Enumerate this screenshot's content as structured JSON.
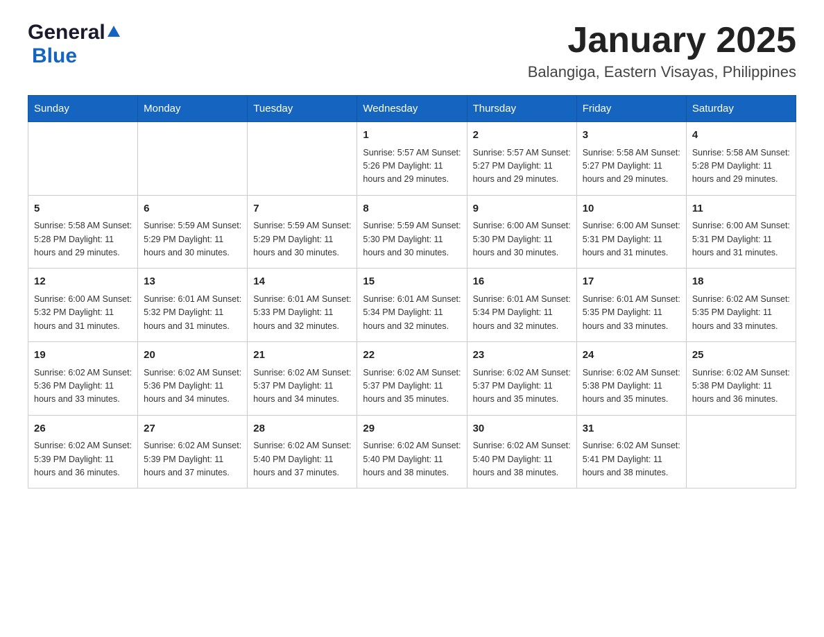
{
  "header": {
    "logo": {
      "general": "General",
      "blue": "Blue"
    },
    "month_title": "January 2025",
    "location": "Balangiga, Eastern Visayas, Philippines"
  },
  "calendar": {
    "days_of_week": [
      "Sunday",
      "Monday",
      "Tuesday",
      "Wednesday",
      "Thursday",
      "Friday",
      "Saturday"
    ],
    "weeks": [
      [
        {
          "day": "",
          "info": ""
        },
        {
          "day": "",
          "info": ""
        },
        {
          "day": "",
          "info": ""
        },
        {
          "day": "1",
          "info": "Sunrise: 5:57 AM\nSunset: 5:26 PM\nDaylight: 11 hours and 29 minutes."
        },
        {
          "day": "2",
          "info": "Sunrise: 5:57 AM\nSunset: 5:27 PM\nDaylight: 11 hours and 29 minutes."
        },
        {
          "day": "3",
          "info": "Sunrise: 5:58 AM\nSunset: 5:27 PM\nDaylight: 11 hours and 29 minutes."
        },
        {
          "day": "4",
          "info": "Sunrise: 5:58 AM\nSunset: 5:28 PM\nDaylight: 11 hours and 29 minutes."
        }
      ],
      [
        {
          "day": "5",
          "info": "Sunrise: 5:58 AM\nSunset: 5:28 PM\nDaylight: 11 hours and 29 minutes."
        },
        {
          "day": "6",
          "info": "Sunrise: 5:59 AM\nSunset: 5:29 PM\nDaylight: 11 hours and 30 minutes."
        },
        {
          "day": "7",
          "info": "Sunrise: 5:59 AM\nSunset: 5:29 PM\nDaylight: 11 hours and 30 minutes."
        },
        {
          "day": "8",
          "info": "Sunrise: 5:59 AM\nSunset: 5:30 PM\nDaylight: 11 hours and 30 minutes."
        },
        {
          "day": "9",
          "info": "Sunrise: 6:00 AM\nSunset: 5:30 PM\nDaylight: 11 hours and 30 minutes."
        },
        {
          "day": "10",
          "info": "Sunrise: 6:00 AM\nSunset: 5:31 PM\nDaylight: 11 hours and 31 minutes."
        },
        {
          "day": "11",
          "info": "Sunrise: 6:00 AM\nSunset: 5:31 PM\nDaylight: 11 hours and 31 minutes."
        }
      ],
      [
        {
          "day": "12",
          "info": "Sunrise: 6:00 AM\nSunset: 5:32 PM\nDaylight: 11 hours and 31 minutes."
        },
        {
          "day": "13",
          "info": "Sunrise: 6:01 AM\nSunset: 5:32 PM\nDaylight: 11 hours and 31 minutes."
        },
        {
          "day": "14",
          "info": "Sunrise: 6:01 AM\nSunset: 5:33 PM\nDaylight: 11 hours and 32 minutes."
        },
        {
          "day": "15",
          "info": "Sunrise: 6:01 AM\nSunset: 5:34 PM\nDaylight: 11 hours and 32 minutes."
        },
        {
          "day": "16",
          "info": "Sunrise: 6:01 AM\nSunset: 5:34 PM\nDaylight: 11 hours and 32 minutes."
        },
        {
          "day": "17",
          "info": "Sunrise: 6:01 AM\nSunset: 5:35 PM\nDaylight: 11 hours and 33 minutes."
        },
        {
          "day": "18",
          "info": "Sunrise: 6:02 AM\nSunset: 5:35 PM\nDaylight: 11 hours and 33 minutes."
        }
      ],
      [
        {
          "day": "19",
          "info": "Sunrise: 6:02 AM\nSunset: 5:36 PM\nDaylight: 11 hours and 33 minutes."
        },
        {
          "day": "20",
          "info": "Sunrise: 6:02 AM\nSunset: 5:36 PM\nDaylight: 11 hours and 34 minutes."
        },
        {
          "day": "21",
          "info": "Sunrise: 6:02 AM\nSunset: 5:37 PM\nDaylight: 11 hours and 34 minutes."
        },
        {
          "day": "22",
          "info": "Sunrise: 6:02 AM\nSunset: 5:37 PM\nDaylight: 11 hours and 35 minutes."
        },
        {
          "day": "23",
          "info": "Sunrise: 6:02 AM\nSunset: 5:37 PM\nDaylight: 11 hours and 35 minutes."
        },
        {
          "day": "24",
          "info": "Sunrise: 6:02 AM\nSunset: 5:38 PM\nDaylight: 11 hours and 35 minutes."
        },
        {
          "day": "25",
          "info": "Sunrise: 6:02 AM\nSunset: 5:38 PM\nDaylight: 11 hours and 36 minutes."
        }
      ],
      [
        {
          "day": "26",
          "info": "Sunrise: 6:02 AM\nSunset: 5:39 PM\nDaylight: 11 hours and 36 minutes."
        },
        {
          "day": "27",
          "info": "Sunrise: 6:02 AM\nSunset: 5:39 PM\nDaylight: 11 hours and 37 minutes."
        },
        {
          "day": "28",
          "info": "Sunrise: 6:02 AM\nSunset: 5:40 PM\nDaylight: 11 hours and 37 minutes."
        },
        {
          "day": "29",
          "info": "Sunrise: 6:02 AM\nSunset: 5:40 PM\nDaylight: 11 hours and 38 minutes."
        },
        {
          "day": "30",
          "info": "Sunrise: 6:02 AM\nSunset: 5:40 PM\nDaylight: 11 hours and 38 minutes."
        },
        {
          "day": "31",
          "info": "Sunrise: 6:02 AM\nSunset: 5:41 PM\nDaylight: 11 hours and 38 minutes."
        },
        {
          "day": "",
          "info": ""
        }
      ]
    ]
  }
}
